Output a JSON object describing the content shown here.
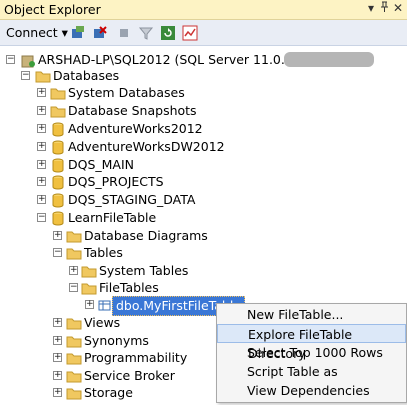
{
  "title": "Object Explorer",
  "title_controls": {
    "dropdown": "▾",
    "pin": "ᵖ",
    "close": "✕"
  },
  "toolbar": {
    "connect_label": "Connect ▾"
  },
  "tree": [
    {
      "label": "ARSHAD-LP\\SQL2012 (SQL Server 11.0.2100 -",
      "icon": "server-icon"
    },
    {
      "label": "Databases",
      "icon": "folder-icon"
    },
    {
      "label": "System Databases",
      "icon": "folder-icon"
    },
    {
      "label": "Database Snapshots",
      "icon": "folder-icon"
    },
    {
      "label": "AdventureWorks2012",
      "icon": "database-icon"
    },
    {
      "label": "AdventureWorksDW2012",
      "icon": "database-icon"
    },
    {
      "label": "DQS_MAIN",
      "icon": "database-icon"
    },
    {
      "label": "DQS_PROJECTS",
      "icon": "database-icon"
    },
    {
      "label": "DQS_STAGING_DATA",
      "icon": "database-icon"
    },
    {
      "label": "LearnFileTable",
      "icon": "database-icon"
    },
    {
      "label": "Database Diagrams",
      "icon": "folder-icon"
    },
    {
      "label": "Tables",
      "icon": "folder-icon"
    },
    {
      "label": "System Tables",
      "icon": "folder-icon"
    },
    {
      "label": "FileTables",
      "icon": "folder-icon"
    },
    {
      "label": "dbo.MyFirstFileTable",
      "icon": "table-icon"
    },
    {
      "label": "Views",
      "icon": "folder-icon"
    },
    {
      "label": "Synonyms",
      "icon": "folder-icon"
    },
    {
      "label": "Programmability",
      "icon": "folder-icon"
    },
    {
      "label": "Service Broker",
      "icon": "folder-icon"
    },
    {
      "label": "Storage",
      "icon": "folder-icon"
    }
  ],
  "context_menu": [
    {
      "label": "New FileTable..."
    },
    {
      "label": "Explore FileTable Directory"
    },
    {
      "label": "Select Top 1000 Rows"
    },
    {
      "label": "Script Table as"
    },
    {
      "label": "View Dependencies"
    }
  ]
}
